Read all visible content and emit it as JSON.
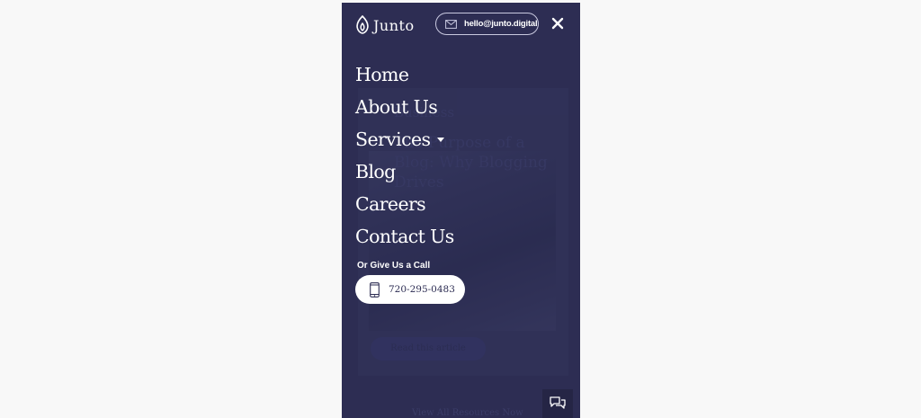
{
  "brand": {
    "name": "Junto"
  },
  "header": {
    "email": "hello@junto.digital"
  },
  "nav": {
    "items": [
      {
        "label": "Home"
      },
      {
        "label": "About Us"
      },
      {
        "label": "Services"
      },
      {
        "label": "Blog"
      },
      {
        "label": "Careers"
      },
      {
        "label": "Contact Us"
      }
    ]
  },
  "call": {
    "label": "Or Give Us a Call",
    "phone": "720-295-0483"
  },
  "background": {
    "category": "Business",
    "title": "The Purpose of a Blog: Why Blogging Drives",
    "cta": "Read this article",
    "footer": "View All Resources Now"
  },
  "colors": {
    "menu_bg": "#2d2d53",
    "page_bg": "#f8f8f8",
    "accent_text": "#ffffff"
  }
}
